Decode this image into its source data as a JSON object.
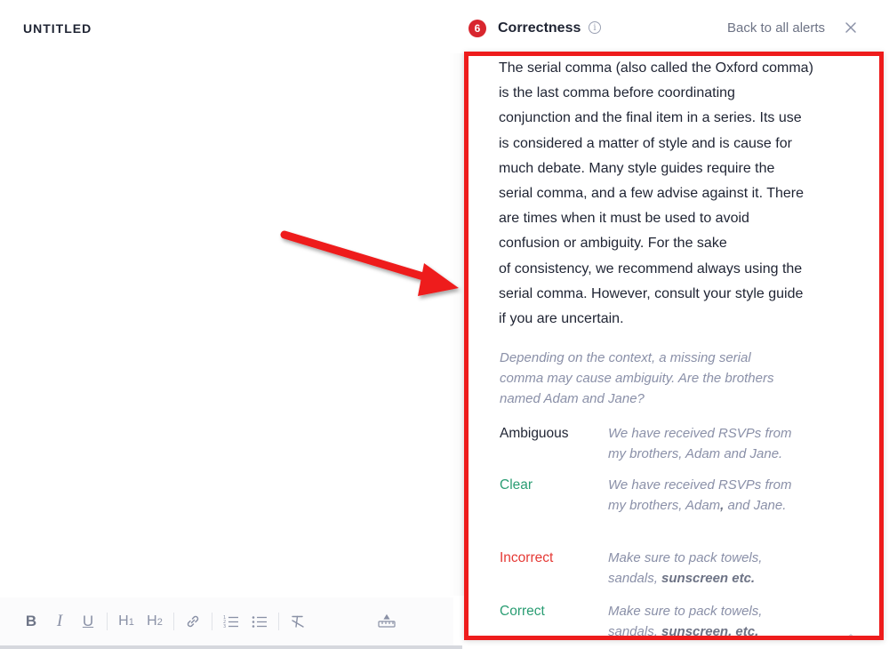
{
  "document": {
    "title": "UNTITLED"
  },
  "toolbar": {
    "bold": "B",
    "italic": "I",
    "underline": "U",
    "h1": "H",
    "h1_sub": "1",
    "h2": "H",
    "h2_sub": "2",
    "icons": [
      "link-icon",
      "numbered-list-icon",
      "bulleted-list-icon",
      "clear-format-icon",
      "ruler-icon"
    ]
  },
  "panel": {
    "badge_count": "6",
    "title": "Correctness",
    "info_icon": "i",
    "back_link": "Back to all alerts",
    "explanation_lines": [
      "The serial comma (also called the Oxford comma)",
      "is the last comma before coordinating",
      "conjunction and the final item in a series. Its use",
      "is considered a matter of style and is cause for",
      "much debate. Many style guides require the",
      "serial comma, and a few advise against it. There",
      "are times when it must be used to avoid",
      "confusion or ambiguity. For the sake",
      "of consistency, we recommend always using the",
      "serial comma. However, consult your style guide",
      "if you are uncertain."
    ],
    "example_intro_lines": [
      "Depending on the context, a missing serial",
      "comma may cause ambiguity. Are the brothers",
      "named Adam and Jane?"
    ],
    "examples": [
      {
        "label": "Ambiguous",
        "line1": "We have received RSVPs from",
        "line2": "my brothers, Adam and Jane."
      },
      {
        "label": "Clear",
        "line1": "We have received RSVPs from",
        "line2_pre": "my brothers, Adam",
        "line2_bold": ",",
        "line2_post": " and Jane."
      },
      {
        "label": "Incorrect",
        "line1": "Make sure to pack towels,",
        "line2_pre": "sandals, ",
        "line2_bold": "sunscreen etc."
      },
      {
        "label": "Correct",
        "line1": "Make sure to pack towels,",
        "line2_pre": "sandals, ",
        "line2_bold": "sunscreen, etc."
      }
    ]
  },
  "colors": {
    "annotation_red": "#ee1c1c",
    "badge_red": "#d8262e",
    "label_green": "#2a9d73",
    "label_red": "#e53935",
    "muted_text": "#8a90a8"
  }
}
